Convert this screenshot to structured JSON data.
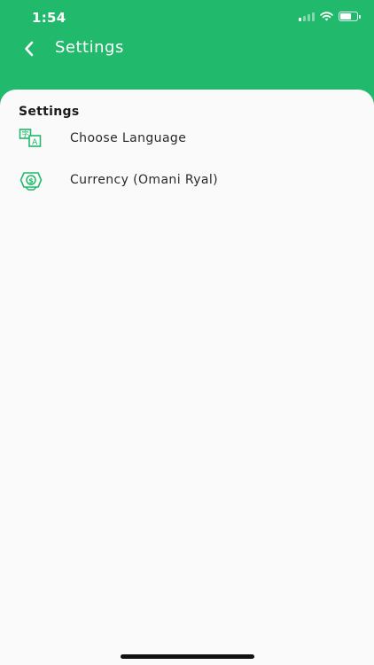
{
  "status_bar": {
    "time": "1:54",
    "icons": [
      "cellular-signal-icon",
      "wifi-icon",
      "battery-icon"
    ],
    "battery_level": 0.7
  },
  "header": {
    "title": "Settings",
    "back_icon": "chevron-left-icon"
  },
  "section": {
    "title": "Settings"
  },
  "items": [
    {
      "label": "Choose Language",
      "icon": "translate-icon"
    },
    {
      "label": "Currency (Omani Ryal)",
      "icon": "money-icon"
    }
  ],
  "colors": {
    "accent": "#21b96b",
    "background": "#fafafa",
    "text": "#2a2a2a"
  }
}
